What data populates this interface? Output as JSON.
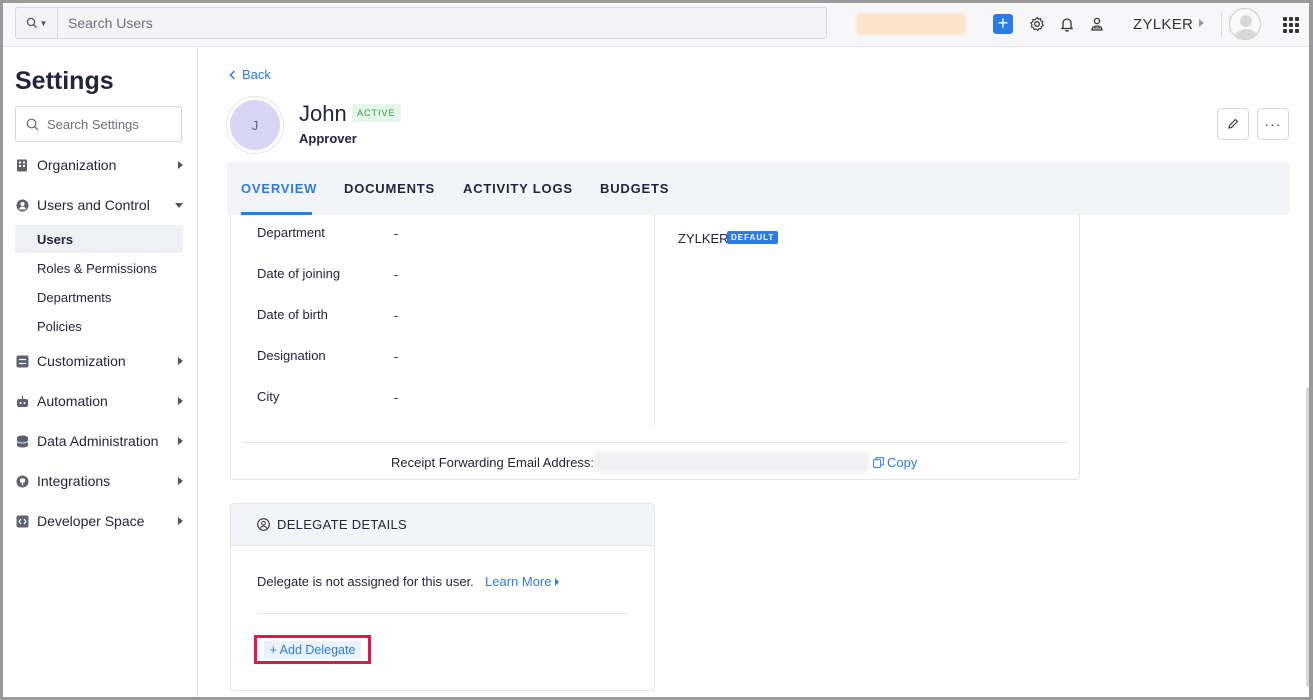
{
  "topbar": {
    "search_placeholder": "Search Users",
    "org_name": "ZYLKER",
    "plus_label": "+"
  },
  "sidebar": {
    "title": "Settings",
    "search_placeholder": "Search Settings",
    "items": [
      {
        "label": "Organization",
        "icon": "building-icon"
      },
      {
        "label": "Users and Control",
        "icon": "user-circle-icon"
      },
      {
        "label": "Customization",
        "icon": "sliders-icon"
      },
      {
        "label": "Automation",
        "icon": "robot-icon"
      },
      {
        "label": "Data Administration",
        "icon": "database-icon"
      },
      {
        "label": "Integrations",
        "icon": "plug-icon"
      },
      {
        "label": "Developer Space",
        "icon": "code-icon"
      }
    ],
    "subitems": [
      "Users",
      "Roles & Permissions",
      "Departments",
      "Policies"
    ]
  },
  "main": {
    "back_label": "Back",
    "user": {
      "initial": "J",
      "name": "John",
      "status": "ACTIVE",
      "role": "Approver"
    },
    "more_label": "···",
    "tabs": [
      "OVERVIEW",
      "DOCUMENTS",
      "ACTIVITY LOGS",
      "BUDGETS"
    ],
    "details": [
      {
        "label": "Department",
        "value": "-"
      },
      {
        "label": "Date of joining",
        "value": "-"
      },
      {
        "label": "Date of birth",
        "value": "-"
      },
      {
        "label": "Designation",
        "value": "-"
      },
      {
        "label": "City",
        "value": "-"
      }
    ],
    "org": {
      "name": "ZYLKER",
      "badge": "DEFAULT"
    },
    "forwarding": {
      "label": "Receipt Forwarding Email Address:",
      "copy_label": "Copy"
    },
    "delegate": {
      "title": "DELEGATE DETAILS",
      "message": "Delegate is not assigned for this user.",
      "learn_more": "Learn More",
      "add_label": "+ Add Delegate"
    }
  },
  "colors": {
    "accent": "#2c7be5",
    "highlight_box": "#e8134b",
    "active_badge": "#2f9a4a"
  }
}
